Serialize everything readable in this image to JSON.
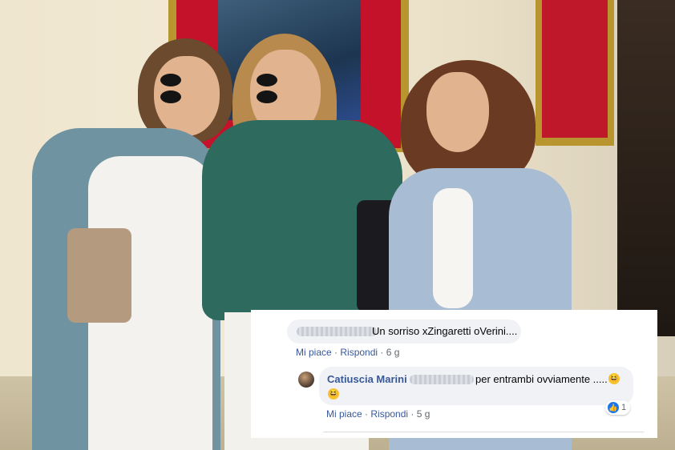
{
  "comments": [
    {
      "text": "Un sorriso xZingaretti oVerini....",
      "actions": {
        "like": "Mi piace",
        "reply": "Rispondi",
        "time": "6 g"
      }
    },
    {
      "author": "Catiuscia Marini",
      "text": "per entrambi ovviamente .....",
      "actions": {
        "like": "Mi piace",
        "reply": "Rispondi",
        "time": "5 g"
      },
      "reaction_count": "1"
    }
  ],
  "icons": {
    "laugh": "laughing-emoji-icon",
    "like": "like-thumb-icon"
  },
  "colors": {
    "link": "#385898",
    "bubble": "#f0f2f5",
    "like": "#1877f2"
  }
}
